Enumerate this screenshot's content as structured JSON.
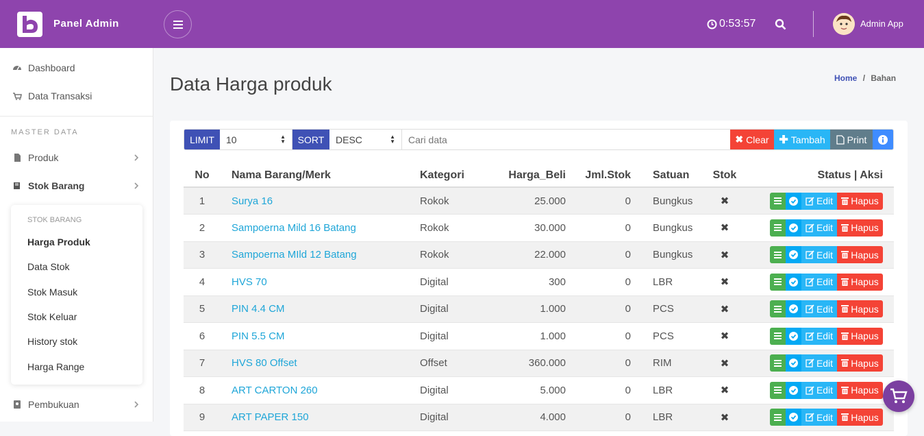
{
  "brand": "Panel Admin",
  "clock": "0:53:57",
  "user": "Admin App",
  "colors": {
    "primary": "#8e44ad",
    "label": "#3f51b5",
    "link": "#1fa6d8",
    "clear": "#f44336",
    "tambah": "#29b6f6",
    "print": "#607d8b",
    "info": "#3f8cff"
  },
  "sidebar": {
    "items": [
      {
        "label": "Dashboard",
        "icon": "dashboard-icon"
      },
      {
        "label": "Data Transaksi",
        "icon": "cart-icon"
      }
    ],
    "section": "MASTER DATA",
    "groups": [
      {
        "label": "Produk",
        "icon": "file-icon"
      },
      {
        "label": "Stok Barang",
        "icon": "book-icon"
      },
      {
        "label": "Pembukuan",
        "icon": "ledger-icon"
      }
    ],
    "submenu": {
      "header": "STOK BARANG",
      "items": [
        "Harga Produk",
        "Data Stok",
        "Stok Masuk",
        "Stok Keluar",
        "History stok",
        "Harga Range"
      ]
    }
  },
  "page": {
    "title": "Data Harga produk",
    "breadcrumb_home": "Home",
    "breadcrumb_sep": "/",
    "breadcrumb_current": "Bahan"
  },
  "filter": {
    "limit_label": "LIMIT",
    "limit_value": "10",
    "sort_label": "SORT",
    "sort_value": "DESC",
    "search_placeholder": "Cari data",
    "clear": "Clear",
    "tambah": "Tambah",
    "print": "Print"
  },
  "table": {
    "headers": [
      "No",
      "Nama Barang/Merk",
      "Kategori",
      "Harga_Beli",
      "Jml.Stok",
      "Satuan",
      "Stok",
      "Status | Aksi"
    ],
    "edit_label": "Edit",
    "hapus_label": "Hapus",
    "rows": [
      {
        "no": "1",
        "nama": "Surya 16",
        "kategori": "Rokok",
        "harga": "25.000",
        "jml": "0",
        "satuan": "Bungkus"
      },
      {
        "no": "2",
        "nama": "Sampoerna Mild 16 Batang",
        "kategori": "Rokok",
        "harga": "30.000",
        "jml": "0",
        "satuan": "Bungkus"
      },
      {
        "no": "3",
        "nama": "Sampoerna MIld 12 Batang",
        "kategori": "Rokok",
        "harga": "22.000",
        "jml": "0",
        "satuan": "Bungkus"
      },
      {
        "no": "4",
        "nama": "HVS 70",
        "kategori": "Digital",
        "harga": "300",
        "jml": "0",
        "satuan": "LBR"
      },
      {
        "no": "5",
        "nama": "PIN 4.4 CM",
        "kategori": "Digital",
        "harga": "1.000",
        "jml": "0",
        "satuan": "PCS"
      },
      {
        "no": "6",
        "nama": "PIN 5.5 CM",
        "kategori": "Digital",
        "harga": "1.000",
        "jml": "0",
        "satuan": "PCS"
      },
      {
        "no": "7",
        "nama": "HVS 80 Offset",
        "kategori": "Offset",
        "harga": "360.000",
        "jml": "0",
        "satuan": "RIM"
      },
      {
        "no": "8",
        "nama": "ART CARTON 260",
        "kategori": "Digital",
        "harga": "5.000",
        "jml": "0",
        "satuan": "LBR"
      },
      {
        "no": "9",
        "nama": "ART PAPER 150",
        "kategori": "Digital",
        "harga": "4.000",
        "jml": "0",
        "satuan": "LBR"
      }
    ]
  }
}
